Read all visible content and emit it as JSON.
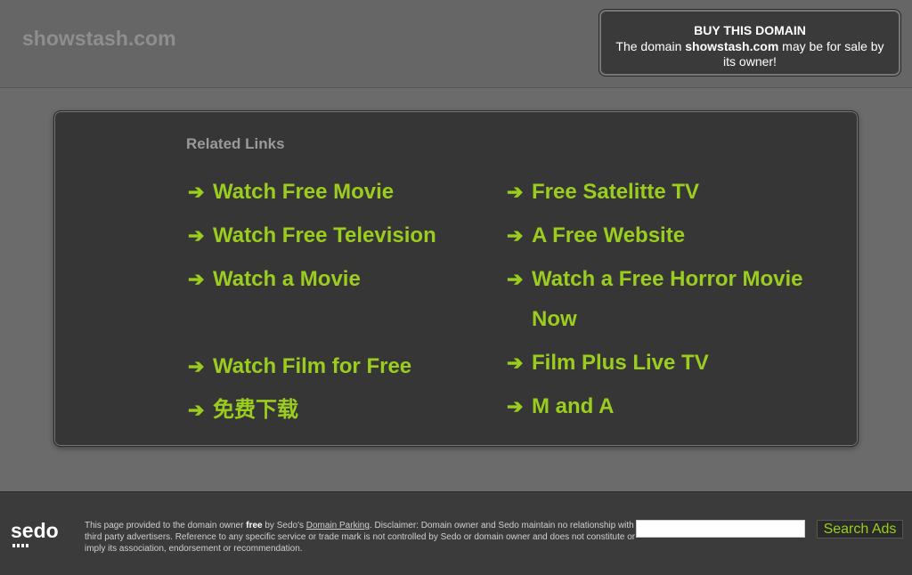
{
  "header": {
    "domain": "showstash.com"
  },
  "buy_box": {
    "title": "BUY THIS DOMAIN",
    "text_before": "The domain ",
    "domain": "showstash.com",
    "text_after": " may be for sale by its owner!"
  },
  "related": {
    "title": "Related Links",
    "arrow": "➔",
    "left": [
      {
        "label": "Watch Free Movie"
      },
      {
        "label": "Watch Free Television"
      },
      {
        "label": "Watch a Movie"
      },
      {
        "label": "Watch Film for Free"
      },
      {
        "label": "免费下载"
      }
    ],
    "right": [
      {
        "label": "Free Satelitte TV"
      },
      {
        "label": "A Free Website"
      },
      {
        "label": "Watch a Free Horror Movie Now"
      },
      {
        "label": "Film Plus Live TV"
      },
      {
        "label": "M and A"
      }
    ]
  },
  "footer": {
    "logo_text": "sedo",
    "disclaimer_1": "This page provided to the domain owner ",
    "disclaimer_free": "free",
    "disclaimer_2": " by Sedo's ",
    "disclaimer_link": "Domain Parking",
    "disclaimer_3": ". Disclaimer: Domain owner and Sedo maintain no relationship with third party advertisers. Reference to any specific service or trade mark is not controlled by Sedo or domain owner and does not constitute or imply its association, endorsement or recommendation.",
    "search_button": "Search Ads",
    "search_value": ""
  },
  "colors": {
    "accent": "#9acd1e",
    "panel": "#363636",
    "background": "#6b6b6b"
  }
}
